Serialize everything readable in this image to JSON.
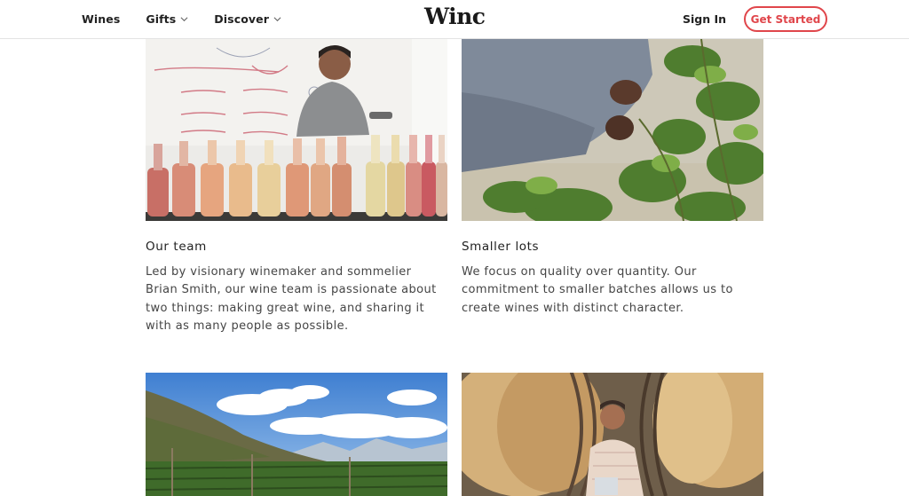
{
  "header": {
    "nav": [
      {
        "label": "Wines",
        "has_dropdown": false
      },
      {
        "label": "Gifts",
        "has_dropdown": true
      },
      {
        "label": "Discover",
        "has_dropdown": true
      }
    ],
    "logo": "Winc",
    "sign_in": "Sign In",
    "cta": "Get Started",
    "accent_color": "#e0464b"
  },
  "features": [
    {
      "title": "Our team",
      "body": "Led by visionary winemaker and sommelier Brian Smith, our wine team is passionate about two things: making great wine, and sharing it with as many people as possible.",
      "image": "winemaker-with-bottles-photo"
    },
    {
      "title": "Smaller lots",
      "body": "We focus on quality over quantity. Our commitment to smaller batches allows us to create wines with distinct character.",
      "image": "grape-vine-harvest-photo"
    },
    {
      "title": "",
      "body": "",
      "image": "vineyard-mountains-photo"
    },
    {
      "title": "",
      "body": "",
      "image": "barrel-cellar-photo"
    }
  ]
}
